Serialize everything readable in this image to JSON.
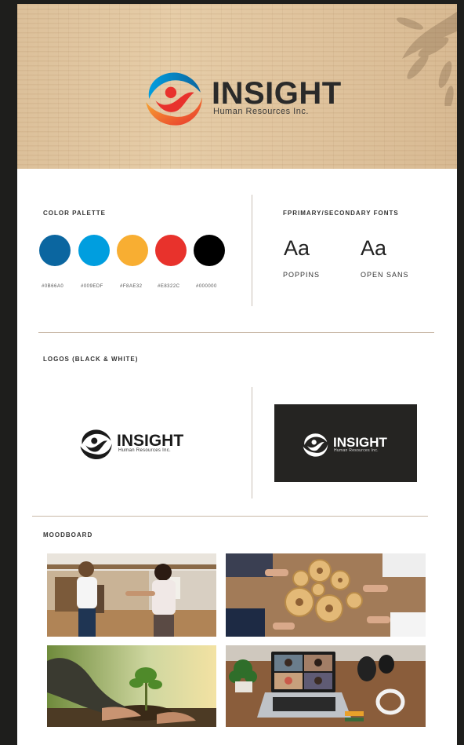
{
  "brand": {
    "name": "INSIGHT",
    "tagline": "Human Resources Inc."
  },
  "colors": {
    "blue_dark": "#0B66A0",
    "blue_light": "#009EDF",
    "orange": "#F8AE32",
    "red": "#E8322C",
    "black": "#000000",
    "page_bg": "#1e1e1c"
  },
  "palette": {
    "heading": "COLOR PALETTE",
    "swatches": [
      {
        "hex": "#0B66A0",
        "label": "#0B66A0"
      },
      {
        "hex": "#009EDF",
        "label": "#009EDF"
      },
      {
        "hex": "#F8AE32",
        "label": "#F8AE32"
      },
      {
        "hex": "#E8322C",
        "label": "#E8322C"
      },
      {
        "hex": "#000000",
        "label": "#000000"
      }
    ]
  },
  "fonts": {
    "heading": "FPRIMARY/SECONDARY FONTS",
    "items": [
      {
        "sample": "Aa",
        "name": "POPPINS"
      },
      {
        "sample": "Aa",
        "name": "OPEN SANS"
      }
    ]
  },
  "logos": {
    "heading": "LOGOS (BLACK & WHITE)"
  },
  "moodboard": {
    "heading": "MOODBOARD",
    "photos": [
      "office-handshake-photo",
      "gears-teamwork-photo",
      "planting-sapling-photo",
      "video-call-laptop-photo"
    ]
  }
}
